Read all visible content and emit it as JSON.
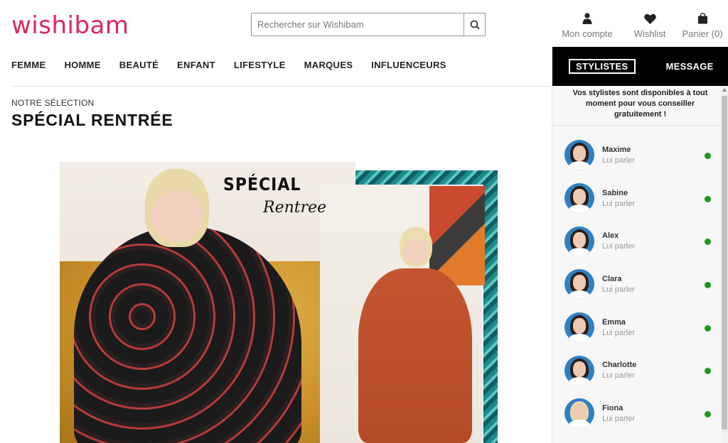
{
  "brand": {
    "logo_text": "wishibam",
    "color": "#e0245e"
  },
  "search": {
    "placeholder": "Rechercher sur Wishibam",
    "icon": "search-icon"
  },
  "header_actions": {
    "account": {
      "label": "Mon compte",
      "icon": "user-icon"
    },
    "wishlist": {
      "label": "Wishlist",
      "icon": "heart-icon"
    },
    "cart": {
      "label": "Panier (0)",
      "icon": "shopping-bag-icon"
    }
  },
  "nav": {
    "items": [
      {
        "label": "FEMME"
      },
      {
        "label": "HOMME"
      },
      {
        "label": "BEAUTÉ"
      },
      {
        "label": "ENFANT"
      },
      {
        "label": "LIFESTYLE"
      },
      {
        "label": "MARQUES"
      },
      {
        "label": "INFLUENCEURS"
      }
    ]
  },
  "main": {
    "eyebrow": "NOTRE SÉLECTION",
    "title": "SPÉCIAL RENTRÉE",
    "hero": {
      "text_line1": "SPÉCIAL",
      "text_line2": "Rentree"
    }
  },
  "chat": {
    "tabs": {
      "stylists": "STYLISTES",
      "message": "MESSAGE"
    },
    "intro": "Vos stylistes sont disponibles à tout moment pour vous conseiller gratuitement !",
    "online_color": "#1a9a1a",
    "stylists": [
      {
        "name": "Maxime",
        "status": "Lui parler"
      },
      {
        "name": "Sabine",
        "status": "Lui parler"
      },
      {
        "name": "Alex",
        "status": "Lui parler"
      },
      {
        "name": "Clara",
        "status": "Lui parler"
      },
      {
        "name": "Emma",
        "status": "Lui parler"
      },
      {
        "name": "Charlotte",
        "status": "Lui parler"
      },
      {
        "name": "Fiona",
        "status": "Lui parler"
      }
    ]
  }
}
